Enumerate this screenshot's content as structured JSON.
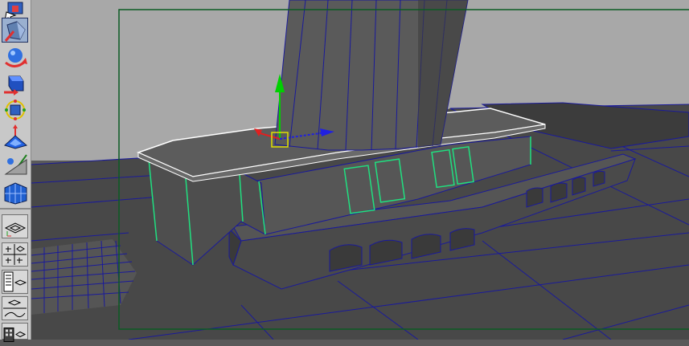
{
  "app": {
    "title": "",
    "accent": "#203060",
    "resolution_gate_color": "#0b5a22",
    "wireframe_color": "#1a1a9a",
    "selection_color": "#20e080"
  },
  "toolbox": {
    "tools": [
      {
        "icon": "select-tool-icon"
      },
      {
        "icon": "lasso-tool-icon"
      },
      {
        "icon": "move-tool-icon"
      },
      {
        "icon": "rotate-tool-icon"
      },
      {
        "icon": "scale-tool-icon"
      },
      {
        "icon": "universal-manipulator-icon"
      },
      {
        "icon": "soft-modification-icon"
      },
      {
        "icon": "show-manipulator-icon"
      },
      {
        "icon": "last-tool-icon"
      }
    ],
    "layouts": [
      {
        "icon": "single-perspective-layout-icon"
      },
      {
        "icon": "four-view-layout-icon"
      },
      {
        "icon": "persp-outliner-layout-icon"
      },
      {
        "icon": "persp-graph-layout-icon"
      },
      {
        "icon": "hypershade-layout-icon"
      }
    ]
  },
  "viewport": {
    "camera": "persp",
    "resolution_gate": true,
    "shading": "smooth-shaded-wireframe-on-shaded"
  }
}
